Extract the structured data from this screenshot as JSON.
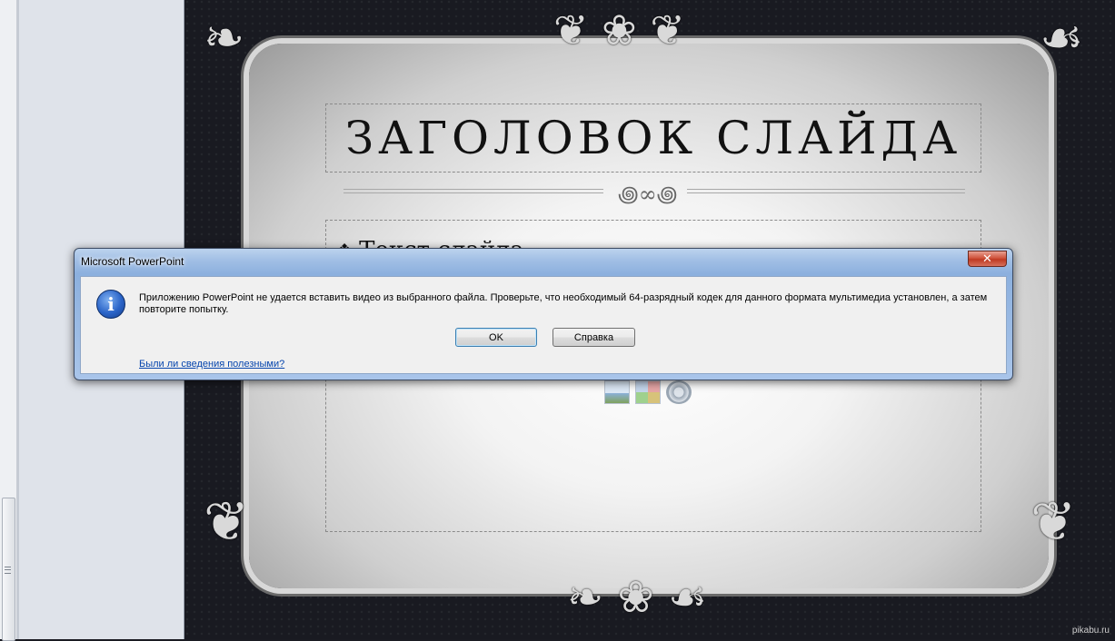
{
  "slide": {
    "title": "ЗАГОЛОВОК СЛАЙДА",
    "bullet": "Текст слайда"
  },
  "dialog": {
    "title": "Microsoft PowerPoint",
    "message": "Приложению PowerPoint не удается вставить видео из выбранного файла. Проверьте, что необходимый 64-разрядный кодек для данного формата мультимедиа установлен, а затем повторите попытку.",
    "ok_label": "OK",
    "help_label": "Справка",
    "feedback_link": "Были ли сведения полезными?"
  },
  "watermark": "pikabu.ru",
  "icons": {
    "close": "close-icon",
    "info": "info-icon",
    "insert_picture": "insert-picture-icon",
    "insert_smartart": "insert-smartart-icon",
    "insert_media": "insert-media-icon"
  },
  "colors": {
    "dialog_frame": "#9fbde4",
    "close_button": "#c74530",
    "link": "#0645ad",
    "slide_background": "#191a21"
  }
}
